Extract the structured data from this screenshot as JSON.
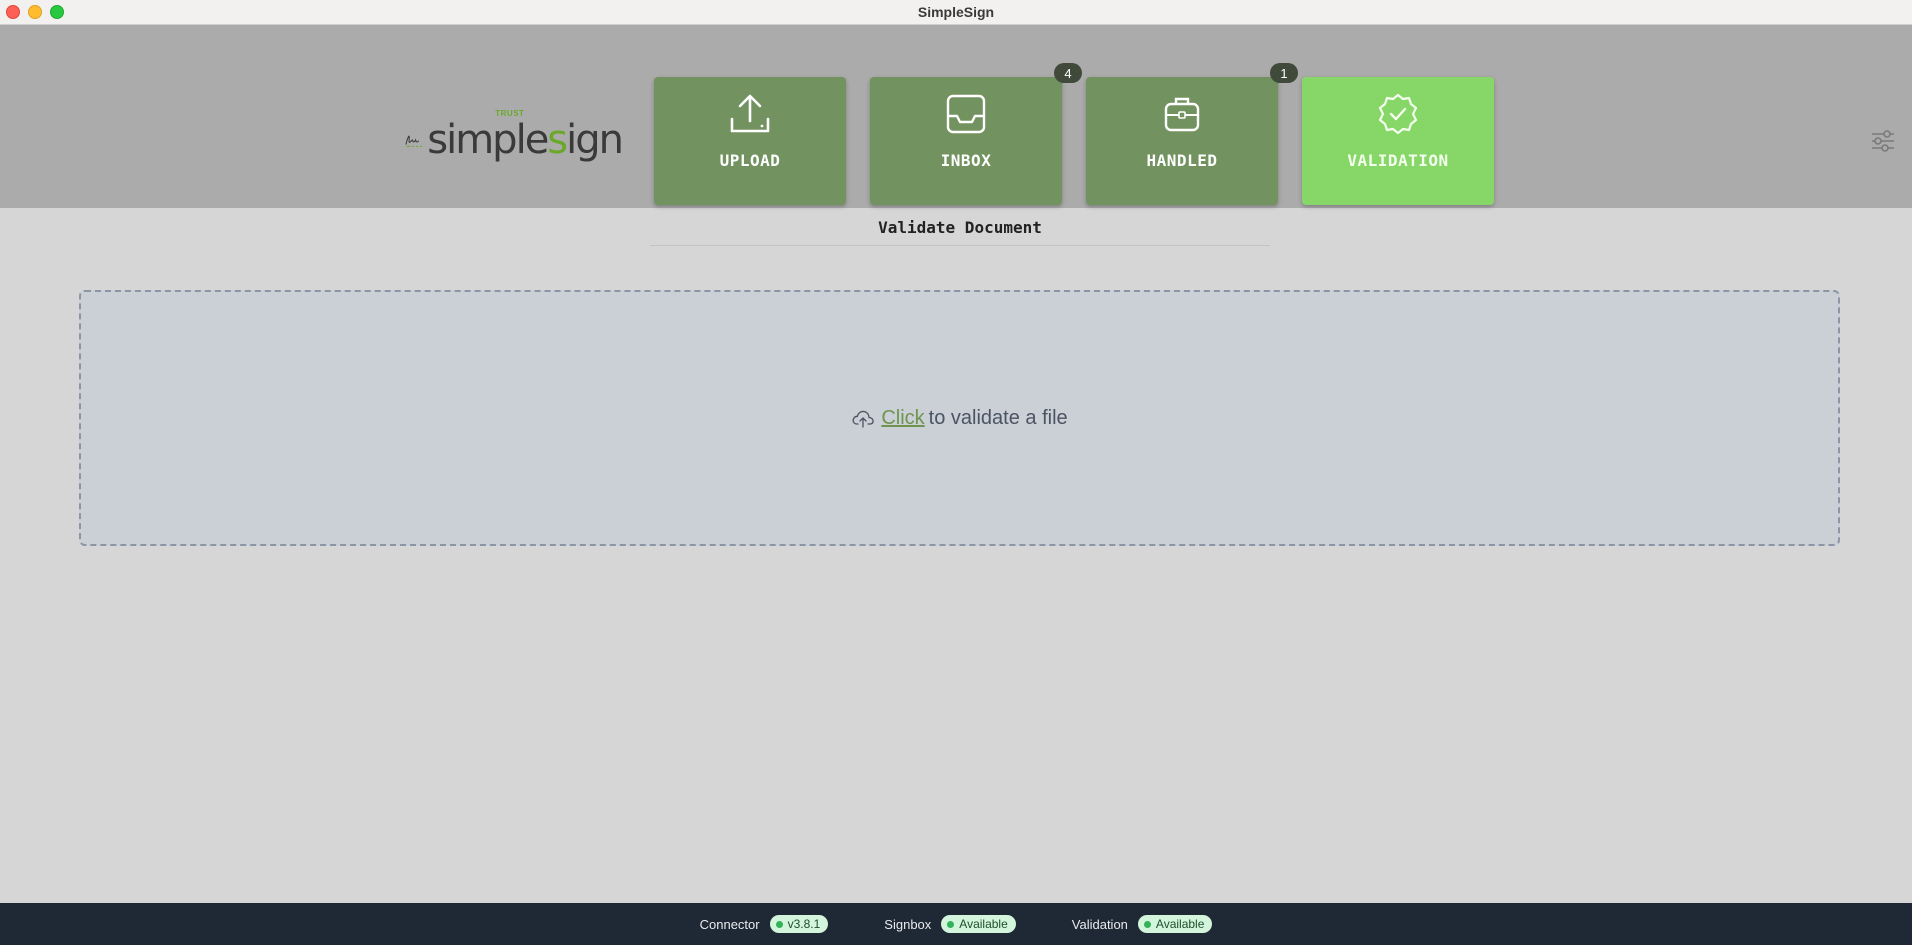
{
  "window": {
    "title": "SimpleSign"
  },
  "logo": {
    "trust": "TRUST",
    "word_a": "simple",
    "word_s": "s",
    "word_b": "ign"
  },
  "nav": {
    "upload": {
      "label": "UPLOAD"
    },
    "inbox": {
      "label": "INBOX",
      "badge": "4"
    },
    "handled": {
      "label": "HANDLED",
      "badge": "1"
    },
    "validation": {
      "label": "VALIDATION",
      "active": true
    }
  },
  "main": {
    "title": "Validate Document",
    "dropzone": {
      "link": "Click",
      "text": "to validate a file"
    }
  },
  "footer": {
    "connector": {
      "label": "Connector",
      "value": "v3.8.1"
    },
    "signbox": {
      "label": "Signbox",
      "value": "Available"
    },
    "validation": {
      "label": "Validation",
      "value": "Available"
    }
  },
  "colors": {
    "nav_default": "#72925f",
    "nav_active": "#86d767",
    "link": "#6f9450",
    "status_ok": "#31b35a",
    "footer_bg": "#1f2935"
  },
  "icons": [
    "upload-icon",
    "inbox-icon",
    "briefcase-icon",
    "verified-badge-icon",
    "sliders-icon",
    "cloud-upload-icon"
  ]
}
